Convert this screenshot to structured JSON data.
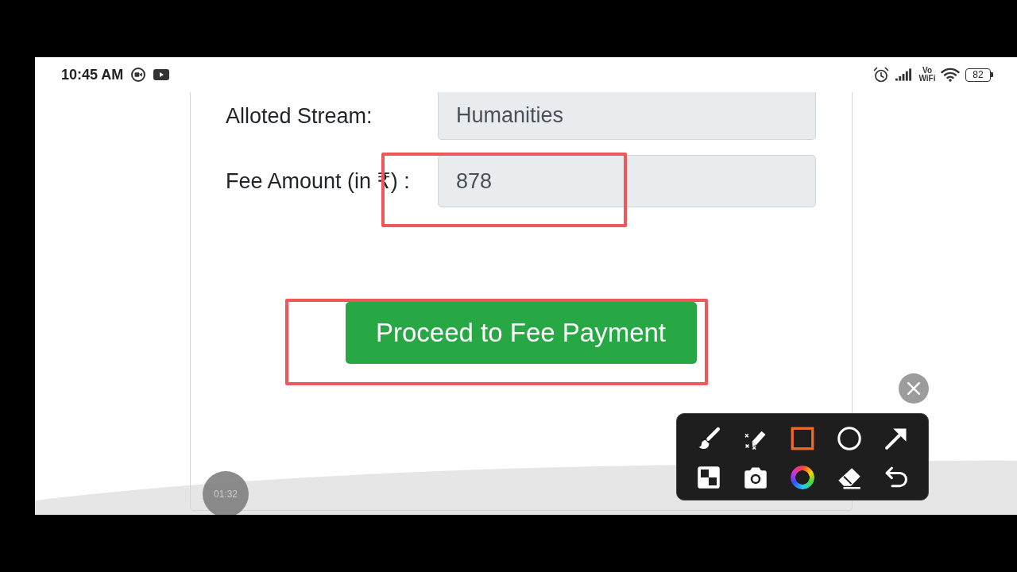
{
  "status_bar": {
    "time": "10:45 AM",
    "vowifi_label": "Vo WiFi",
    "battery": "82"
  },
  "form": {
    "fields": [
      {
        "label": "Alloted Stream:",
        "value": "Humanities",
        "readonly": true
      },
      {
        "label": "Fee Amount (in ₹) :",
        "value": "878",
        "readonly": true
      }
    ],
    "submit_button": "Proceed to Fee Payment"
  },
  "annotations": [
    {
      "kind": "rectangle"
    },
    {
      "kind": "rectangle"
    }
  ],
  "recording": {
    "elapsed": "01:32"
  },
  "drawing_toolbar": {
    "tools": [
      {
        "kind": "brush",
        "selected": false
      },
      {
        "kind": "highlighter",
        "selected": false
      },
      {
        "kind": "rectangle",
        "selected": true
      },
      {
        "kind": "ellipse",
        "selected": false
      },
      {
        "kind": "arrow",
        "selected": false
      },
      {
        "kind": "mosaic",
        "selected": false
      },
      {
        "kind": "screenshot",
        "selected": false
      },
      {
        "kind": "color",
        "selected": false
      },
      {
        "kind": "eraser",
        "selected": false
      },
      {
        "kind": "undo",
        "selected": false
      }
    ]
  }
}
